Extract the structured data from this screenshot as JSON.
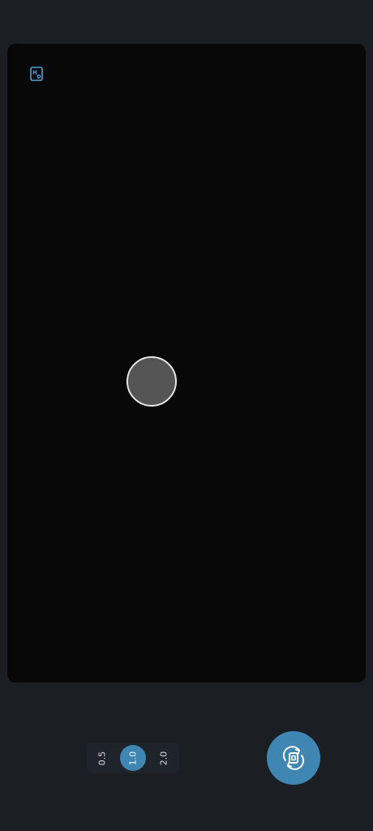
{
  "camera": {
    "hdr_icon": "hdr-icon",
    "switch_icon": "switch-camera-icon"
  },
  "zoom": {
    "options": [
      "0.5",
      "1.0",
      "2.0"
    ],
    "selected": "1.0"
  },
  "colors": {
    "background": "#1b1f24",
    "viewfinder": "#090808",
    "accent": "#3f86b3",
    "focus_ring": "#e6e6e6"
  }
}
